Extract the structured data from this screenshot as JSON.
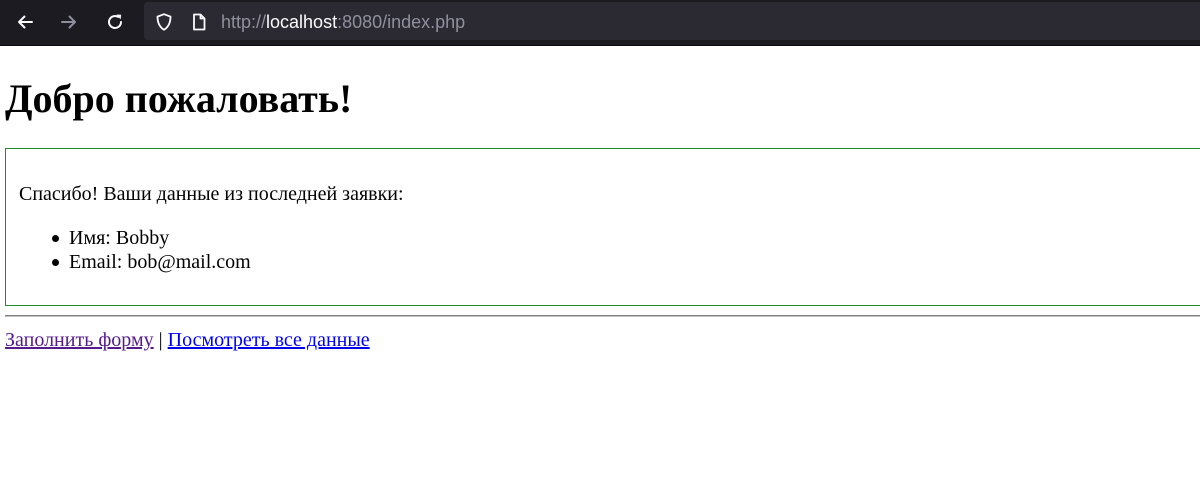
{
  "browser": {
    "back_icon": "arrow-left-icon",
    "forward_icon": "arrow-right-icon",
    "reload_icon": "reload-icon",
    "tracking_icon": "shield-icon",
    "page_icon": "document-icon",
    "url_prefix": "http://",
    "url_host": "localhost",
    "url_suffix": ":8080/index.php"
  },
  "page": {
    "title": "Добро пожаловать!",
    "message": {
      "text": "Спасибо! Ваши данные из последней заявки:",
      "items": [
        "Имя: Bobby",
        "Email: bob@mail.com"
      ],
      "border_color": "#1f8a2e"
    },
    "links": {
      "fill_form": "Заполнить форму",
      "separator": "|",
      "view_all": "Посмотреть все данные"
    }
  },
  "colors": {
    "toolbar_bg": "#1c1b22",
    "urlbar_bg": "#2b2a33",
    "visited_link": "#551a8b",
    "link": "#0000ee"
  }
}
